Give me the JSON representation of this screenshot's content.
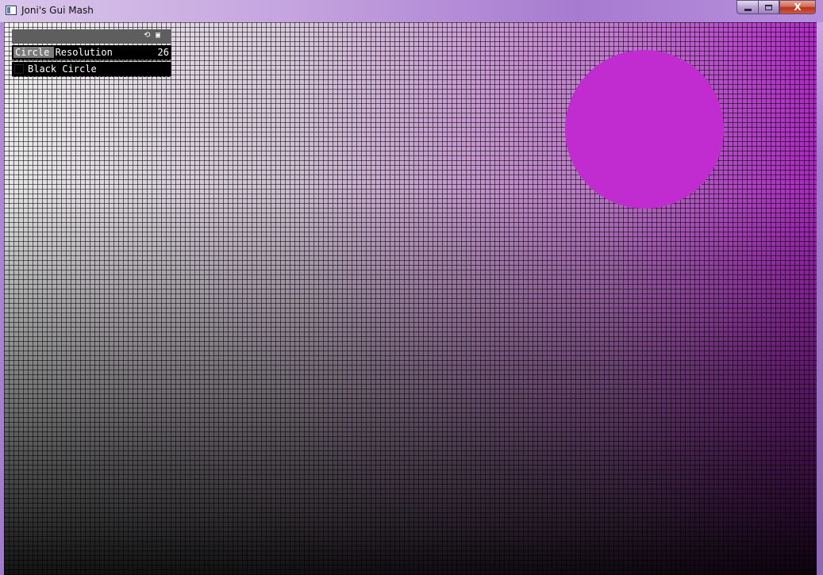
{
  "window": {
    "title": "Joni's Gui Mash",
    "close_glyph": "X"
  },
  "gui": {
    "icons": [
      "refresh-icon",
      "save-icon"
    ],
    "slider": {
      "label": "Circle Resolution",
      "value": "26",
      "fill_fraction": 0.26
    },
    "toggle": {
      "label": "Black Circle",
      "checked": false
    }
  },
  "scene": {
    "circle_color": "#c02cd0"
  },
  "colors": {
    "gui_header": "#5e5e5e",
    "gui_row": "#000000",
    "slider_fill": "#7a7a7a"
  }
}
